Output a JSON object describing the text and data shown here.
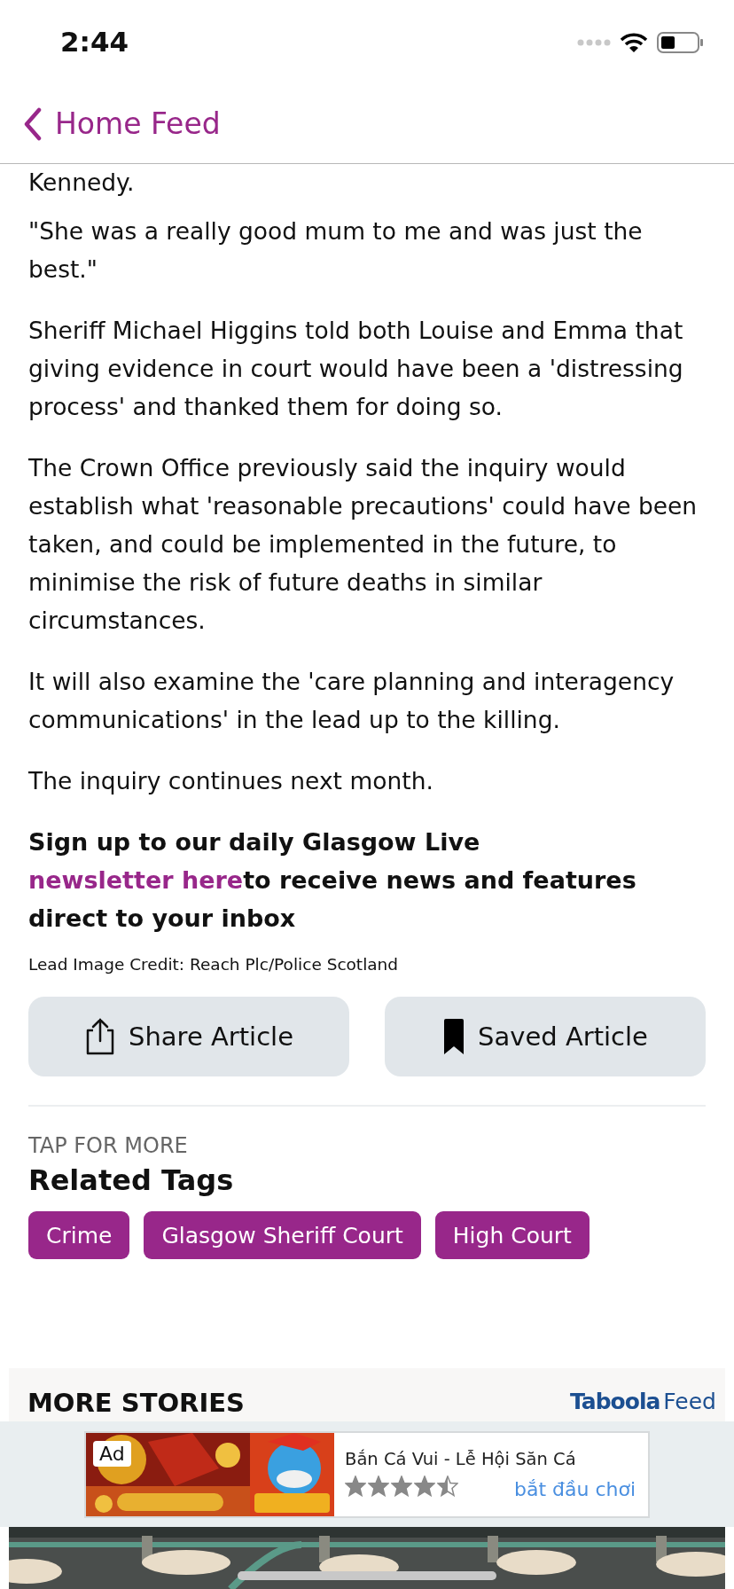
{
  "status_bar": {
    "time": "2:44"
  },
  "nav": {
    "back_label": "Home Feed"
  },
  "article": {
    "paragraphs": [
      "Kennedy.",
      "\"She was a really good mum to me and was just the best.\"",
      "Sheriff Michael Higgins told both Louise and Emma that giving evidence in court would have been a 'distressing process' and thanked them for doing so.",
      "The Crown Office previously said the inquiry would establish what 'reasonable precautions' could have been taken, and could be implemented in the future, to minimise the risk of future deaths in similar circumstances.",
      "It will also examine the 'care planning and interagency communications' in the lead up to the killing.",
      "The inquiry continues next month."
    ],
    "signup": {
      "before": "Sign up to our daily Glasgow Live ",
      "link": "newsletter here",
      "after": "to receive news and features direct to your inbox"
    },
    "credit": "Lead Image Credit: Reach Plc/Police Scotland"
  },
  "actions": [
    {
      "kind": "share",
      "label": "Share Article"
    },
    {
      "kind": "saved",
      "label": "Saved Article"
    }
  ],
  "tags_section": {
    "kicker": "TAP FOR MORE",
    "title": "Related Tags",
    "tags": [
      "Crime",
      "Glasgow Sheriff Court",
      "High Court"
    ]
  },
  "more_stories": {
    "title": "MORE STORIES",
    "provider": "Taboola",
    "provider_suffix": "Feed"
  },
  "ad": {
    "badge": "Ad",
    "title": "Bắn Cá Vui - Lễ Hội Săn Cá",
    "stars": 4.5,
    "cta": "bắt đầu chơi"
  }
}
